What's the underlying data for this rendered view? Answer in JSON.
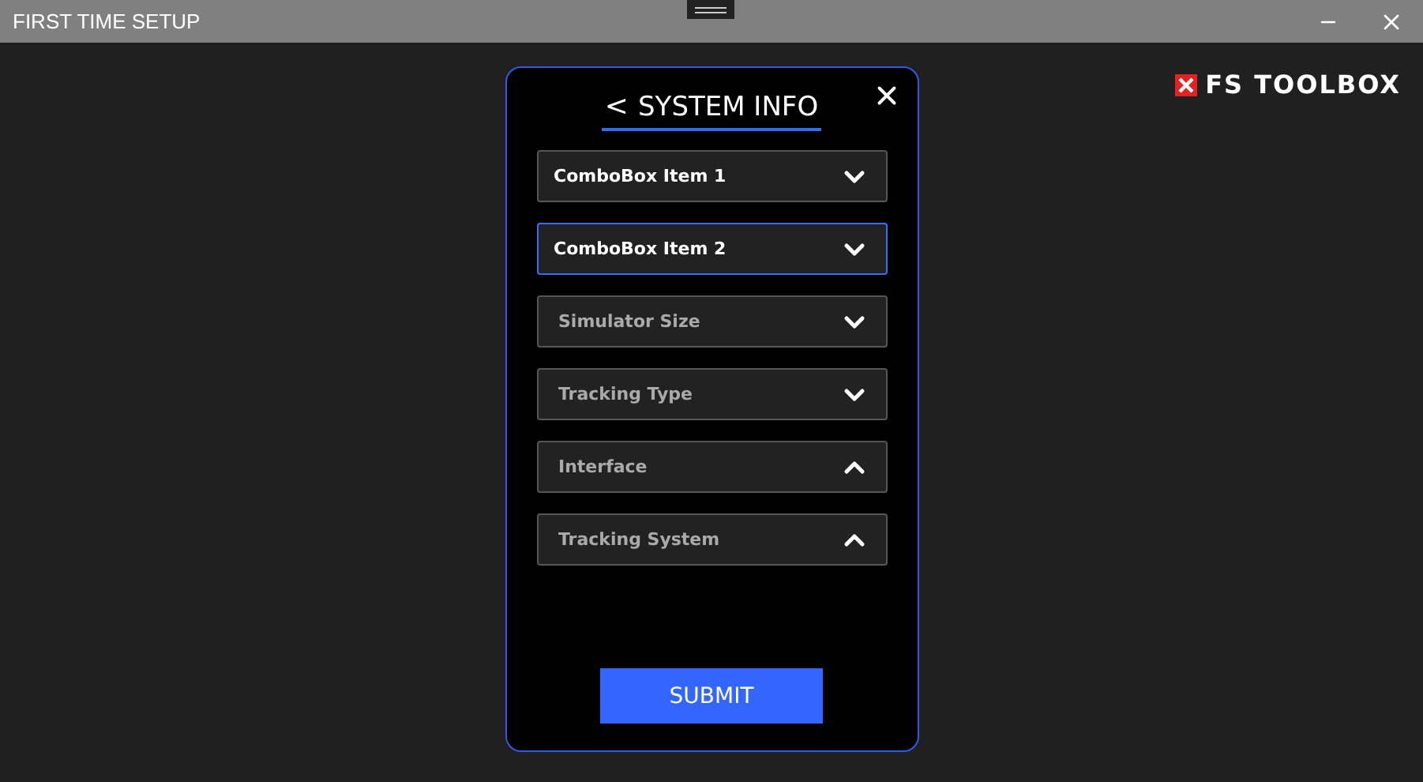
{
  "window": {
    "title": "FIRST TIME SETUP"
  },
  "logo": {
    "text": "FS TOOLBOX"
  },
  "dialog": {
    "back": "<",
    "title": "SYSTEM INFO",
    "fields": [
      {
        "value": "ComboBox Item 1",
        "selected": false,
        "expanded": false
      },
      {
        "value": "ComboBox Item 2",
        "selected": true,
        "expanded": false
      },
      {
        "placeholder": "Simulator Size",
        "selected": false,
        "expanded": false
      },
      {
        "placeholder": "Tracking Type",
        "selected": false,
        "expanded": false
      },
      {
        "placeholder": "Interface",
        "selected": false,
        "expanded": true
      },
      {
        "placeholder": "Tracking System",
        "selected": false,
        "expanded": true
      }
    ],
    "submit": "SUBMIT"
  }
}
